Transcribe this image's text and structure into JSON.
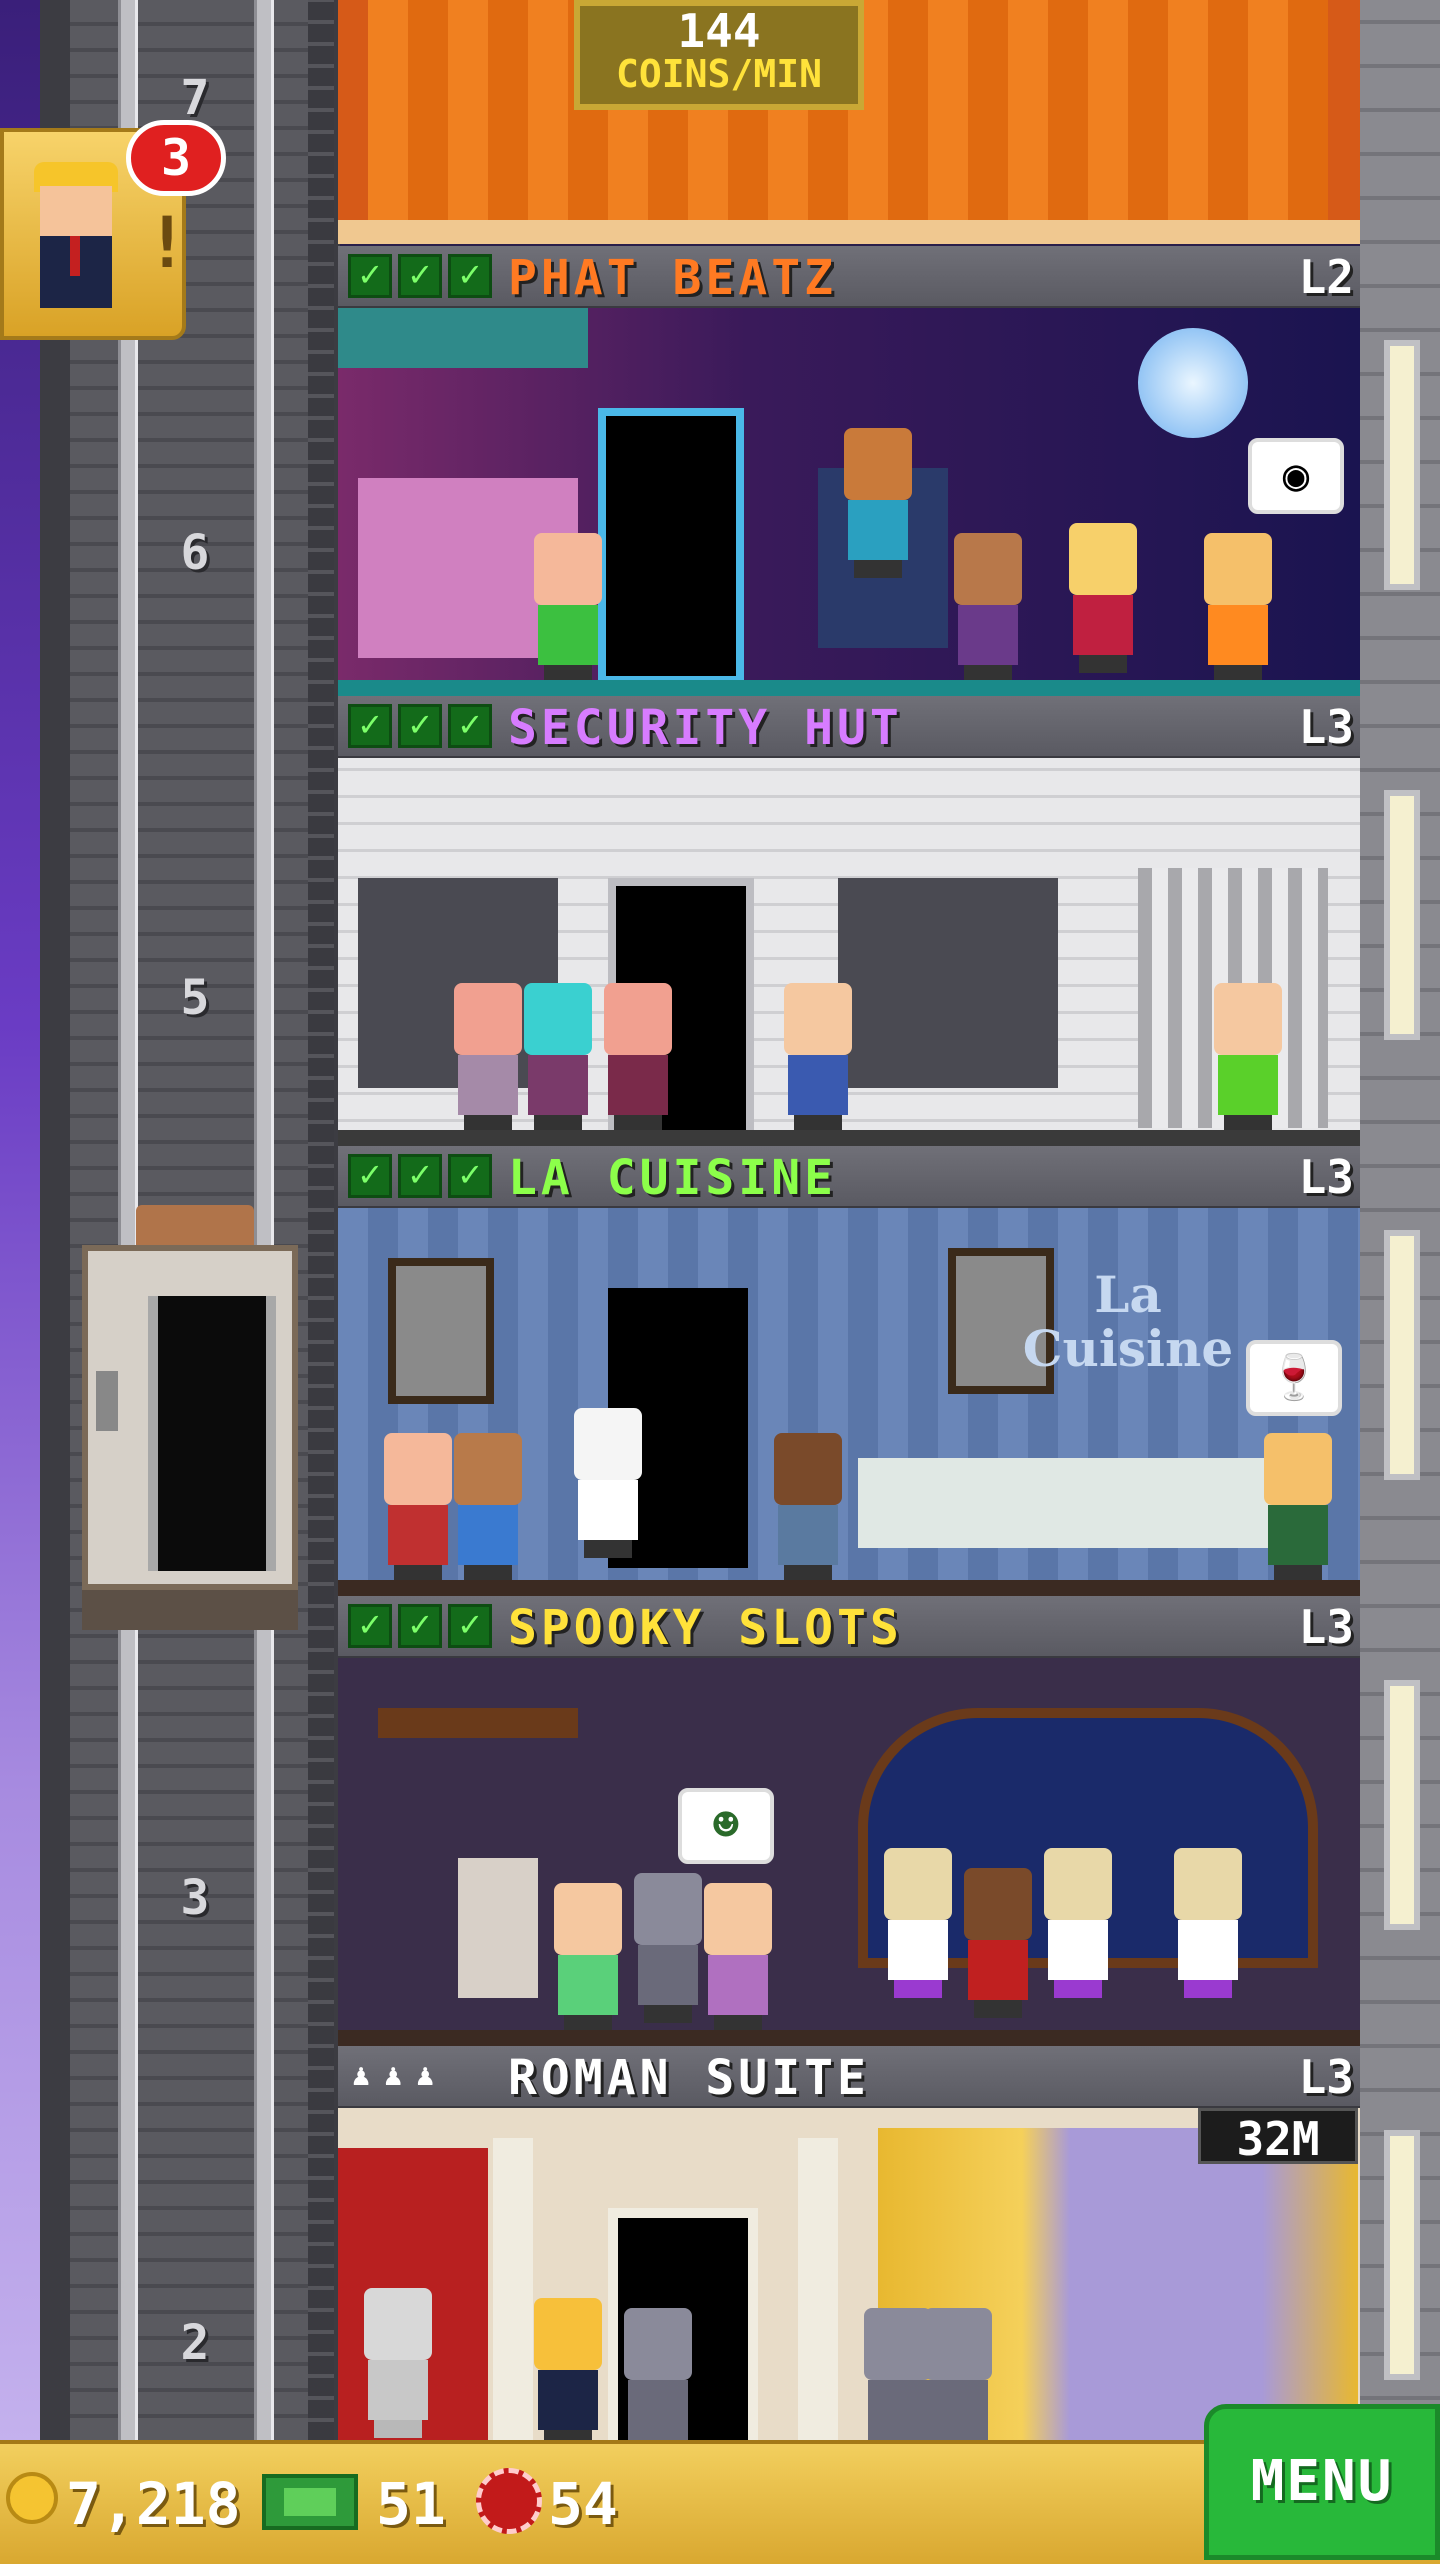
{
  "top_sign": {
    "rate": "144",
    "unit": "COINS/MIN"
  },
  "vip": {
    "notification_count": "3"
  },
  "elevator": {
    "floor_labels": [
      "7",
      "6",
      "5",
      "3",
      "2"
    ]
  },
  "floors": [
    {
      "name": "PHAT BEATZ",
      "level": "L2",
      "stocked_checks": 3,
      "name_color": "#ff7a22",
      "theme": "nightclub",
      "bubble_icon": "coin-icon"
    },
    {
      "name": "SECURITY HUT",
      "level": "L3",
      "stocked_checks": 3,
      "name_color": "#d77cff",
      "theme": "security"
    },
    {
      "name": "LA CUISINE",
      "level": "L3",
      "stocked_checks": 3,
      "name_color": "#8cff4a",
      "theme": "restaurant",
      "sign": "La Cuisine",
      "bubble_icon": "wine-glass-icon"
    },
    {
      "name": "SPOOKY SLOTS",
      "level": "L3",
      "stocked_checks": 3,
      "name_color": "#ffe23a",
      "theme": "casino",
      "bubble_icon": "witch-icon"
    },
    {
      "name": "ROMAN SUITE",
      "level": "L3",
      "stocked_checks": 0,
      "name_color": "#ffffff",
      "theme": "residential",
      "price": "32M"
    }
  ],
  "stats": {
    "coins": "7,218",
    "bux": "51",
    "tokens": "54"
  },
  "menu": {
    "label": "MENU"
  },
  "colors": {
    "bar": "#e9c04a",
    "menu": "#28b83a",
    "check": "#136b1a"
  }
}
